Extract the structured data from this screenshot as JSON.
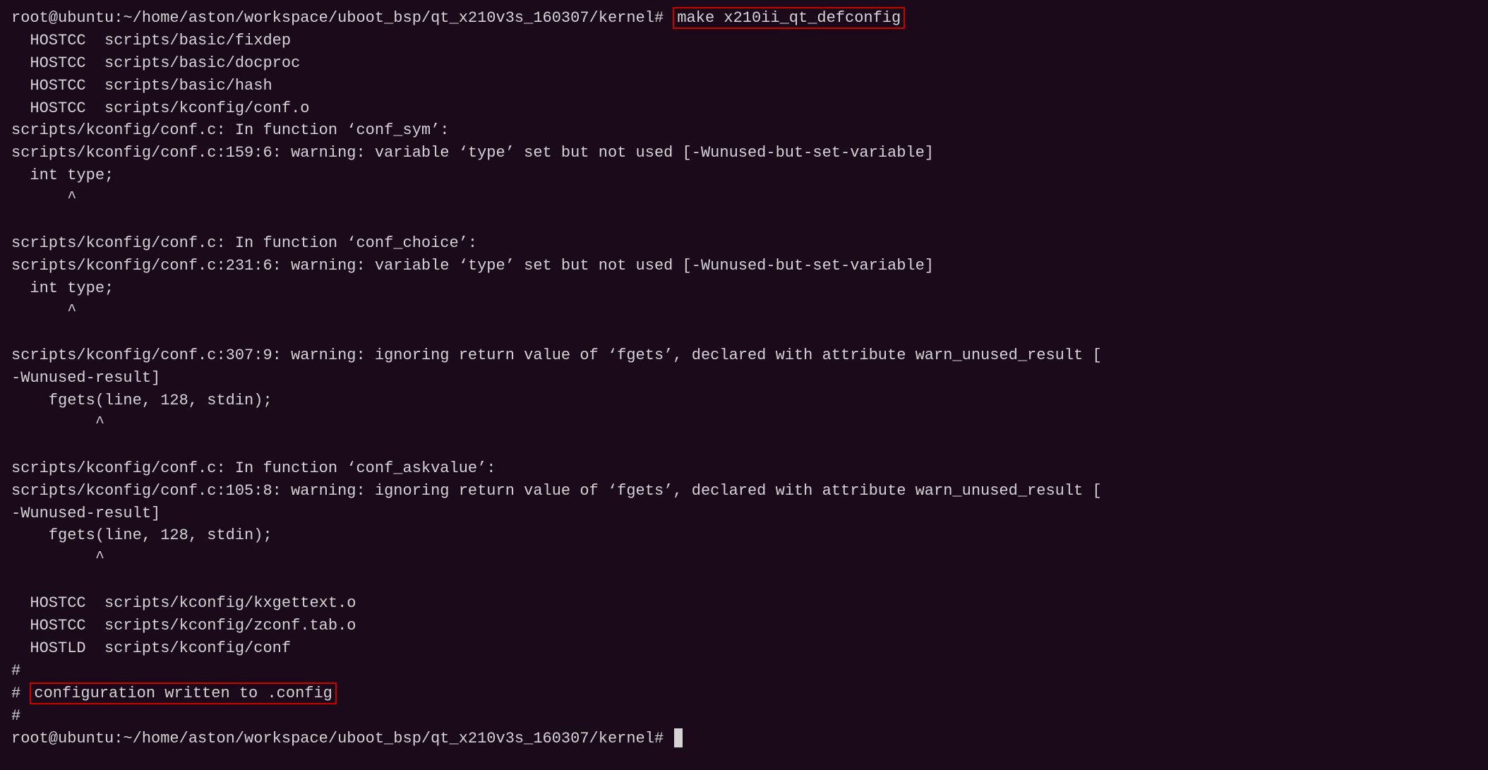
{
  "terminal": {
    "lines": [
      {
        "id": "line-title-bar",
        "text": "root@ubuntu:~/home/aston/workspace/uboot_bsp/qt_x210v3s_160307/kernel#",
        "type": "prompt-only",
        "command": "make x210ii_qt_defconfig",
        "has_command_box": true
      },
      {
        "id": "line-hostcc-fixdep",
        "text": "  HOSTCC  scripts/basic/fixdep",
        "type": "normal"
      },
      {
        "id": "line-hostcc-docproc",
        "text": "  HOSTCC  scripts/basic/docproc",
        "type": "normal"
      },
      {
        "id": "line-hostcc-hash",
        "text": "  HOSTCC  scripts/basic/hash",
        "type": "normal"
      },
      {
        "id": "line-hostcc-conf",
        "text": "  HOSTCC  scripts/kconfig/conf.o",
        "type": "normal"
      },
      {
        "id": "line-conf-func1",
        "text": "scripts/kconfig/conf.c: In function ‘conf_sym’:",
        "type": "normal"
      },
      {
        "id": "line-conf-warn1",
        "text": "scripts/kconfig/conf.c:159:6: warning: variable ‘type’ set but not used [-Wunused-but-set-variable]",
        "type": "normal"
      },
      {
        "id": "line-int-type1",
        "text": "  int type;",
        "type": "normal"
      },
      {
        "id": "line-caret1",
        "text": "      ^",
        "type": "normal"
      },
      {
        "id": "line-empty1",
        "text": "",
        "type": "normal"
      },
      {
        "id": "line-conf-func2",
        "text": "scripts/kconfig/conf.c: In function ‘conf_choice’:",
        "type": "normal"
      },
      {
        "id": "line-conf-warn2",
        "text": "scripts/kconfig/conf.c:231:6: warning: variable ‘type’ set but not used [-Wunused-but-set-variable]",
        "type": "normal"
      },
      {
        "id": "line-int-type2",
        "text": "  int type;",
        "type": "normal"
      },
      {
        "id": "line-caret2",
        "text": "      ^",
        "type": "normal"
      },
      {
        "id": "line-empty2",
        "text": "",
        "type": "normal"
      },
      {
        "id": "line-conf-warn3a",
        "text": "scripts/kconfig/conf.c:307:9: warning: ignoring return value of ‘fgets’, declared with attribute warn_unused_result [",
        "type": "normal"
      },
      {
        "id": "line-conf-warn3b",
        "text": "-Wunused-result]",
        "type": "normal"
      },
      {
        "id": "line-fgets1",
        "text": "    fgets(line, 128, stdin);",
        "type": "normal"
      },
      {
        "id": "line-caret3",
        "text": "         ^",
        "type": "normal"
      },
      {
        "id": "line-empty3",
        "text": "",
        "type": "normal"
      },
      {
        "id": "line-conf-func3",
        "text": "scripts/kconfig/conf.c: In function ‘conf_askvalue’:",
        "type": "normal"
      },
      {
        "id": "line-conf-warn4a",
        "text": "scripts/kconfig/conf.c:105:8: warning: ignoring return value of ‘fgets’, declared with attribute warn_unused_result [",
        "type": "normal"
      },
      {
        "id": "line-conf-warn4b",
        "text": "-Wunused-result]",
        "type": "normal"
      },
      {
        "id": "line-fgets2",
        "text": "    fgets(line, 128, stdin);",
        "type": "normal"
      },
      {
        "id": "line-caret4",
        "text": "         ^",
        "type": "normal"
      },
      {
        "id": "line-empty4",
        "text": "",
        "type": "normal"
      },
      {
        "id": "line-hostcc-kxgettext",
        "text": "  HOSTCC  scripts/kconfig/kxgettext.o",
        "type": "normal"
      },
      {
        "id": "line-hostcc-zconf",
        "text": "  HOSTCC  scripts/kconfig/zconf.tab.o",
        "type": "normal"
      },
      {
        "id": "line-hostld-conf",
        "text": "  HOSTLD  scripts/kconfig/conf",
        "type": "normal"
      },
      {
        "id": "line-hash1",
        "text": "#",
        "type": "normal"
      },
      {
        "id": "line-config-written",
        "text": "# configuration written to .config",
        "type": "highlight",
        "has_highlight_box": true
      },
      {
        "id": "line-hash2",
        "text": "#",
        "type": "normal"
      },
      {
        "id": "line-final-prompt",
        "text": "root@ubuntu:~/home/aston/workspace/uboot_bsp/qt_x210v3s_160307/kernel#",
        "type": "final-prompt"
      }
    ],
    "prompt_text": "root@ubuntu:~/home/aston/workspace/uboot_bsp/qt_x210v3s_160307/kernel#",
    "command_text": "make x210ii_qt_defconfig",
    "config_written_text": "# configuration written to .config"
  }
}
